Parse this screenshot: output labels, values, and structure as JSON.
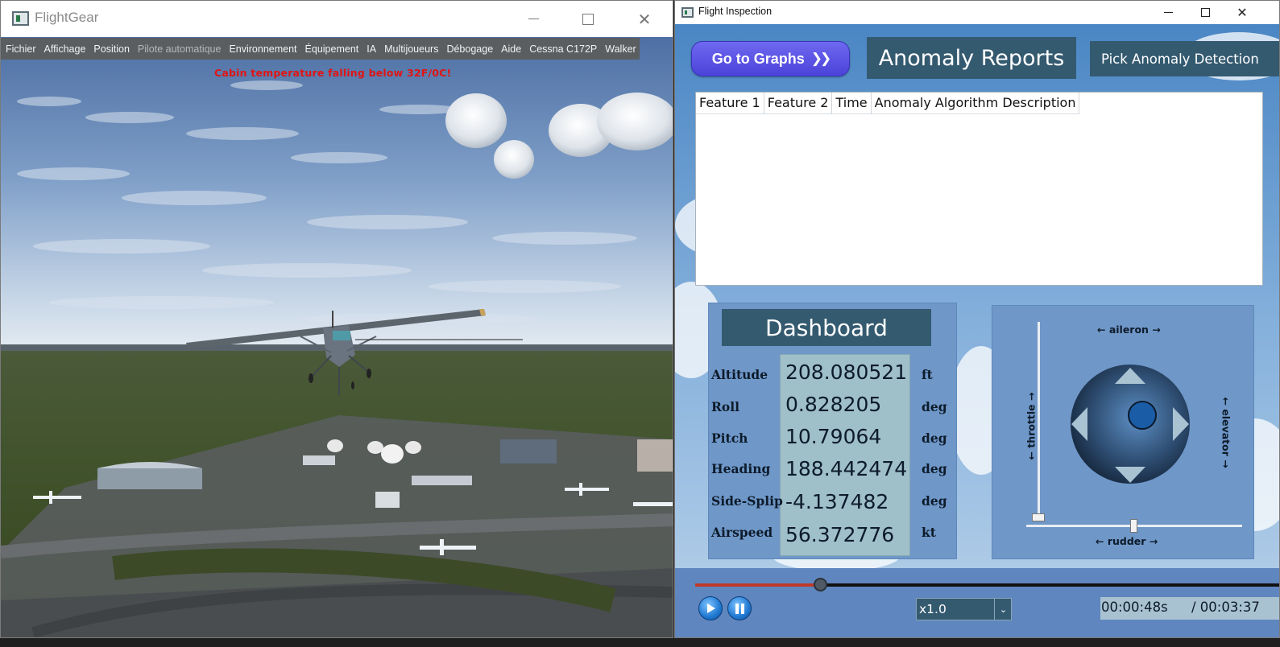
{
  "flightgear": {
    "title": "FlightGear",
    "menu": [
      {
        "label": "Fichier",
        "enabled": true
      },
      {
        "label": "Affichage",
        "enabled": true
      },
      {
        "label": "Position",
        "enabled": true
      },
      {
        "label": "Pilote automatique",
        "enabled": false
      },
      {
        "label": "Environnement",
        "enabled": true
      },
      {
        "label": "Équipement",
        "enabled": true
      },
      {
        "label": "IA",
        "enabled": true
      },
      {
        "label": "Multijoueurs",
        "enabled": true
      },
      {
        "label": "Débogage",
        "enabled": true
      },
      {
        "label": "Aide",
        "enabled": true
      },
      {
        "label": "Cessna C172P",
        "enabled": true
      },
      {
        "label": "Walker",
        "enabled": true
      }
    ],
    "warning": "Cabin temperature falling below 32F/0C!",
    "warning_color": "#e01414"
  },
  "inspection": {
    "title": "Flight Inspection",
    "go_graphs_label": "Go to Graphs",
    "go_graphs_icon": "double-chevron-right-icon",
    "anomaly_header": "Anomaly Reports",
    "pick_anomaly_label": "Pick Anomaly Detection",
    "table_headers": [
      "Feature 1",
      "Feature 2",
      "Time",
      "Anomaly Algorithm Description"
    ],
    "table_rows": [],
    "dashboard": {
      "title": "Dashboard",
      "rows": [
        {
          "label": "Altitude",
          "value": "208.080521",
          "unit": "ft"
        },
        {
          "label": "Roll",
          "value": "0.828205",
          "unit": "deg"
        },
        {
          "label": "Pitch",
          "value": "10.79064",
          "unit": "deg"
        },
        {
          "label": "Heading",
          "value": "188.442474",
          "unit": "deg"
        },
        {
          "label": "Side-Splip",
          "value": "-4.137482",
          "unit": "deg"
        },
        {
          "label": "Airspeed",
          "value": "56.372776",
          "unit": "kt"
        }
      ]
    },
    "joystick": {
      "aileron_label": "← aileron →",
      "elevator_label": "← elevator →",
      "throttle_label": "← throttle →",
      "rudder_label": "← rudder →",
      "throttle_level": 0.0,
      "rudder_level": 0.5
    },
    "playback": {
      "progress": 0.215,
      "speed": "x1.0",
      "current_time": "00:00:48s",
      "total_time": "/ 00:03:37",
      "play_icon": "play-icon",
      "pause_icon": "pause-icon"
    },
    "colors": {
      "header_bg": "#345a70",
      "panel_bg": "#6f97c8",
      "button_primary": "#5a52e6",
      "progress": "#c0392b"
    }
  }
}
